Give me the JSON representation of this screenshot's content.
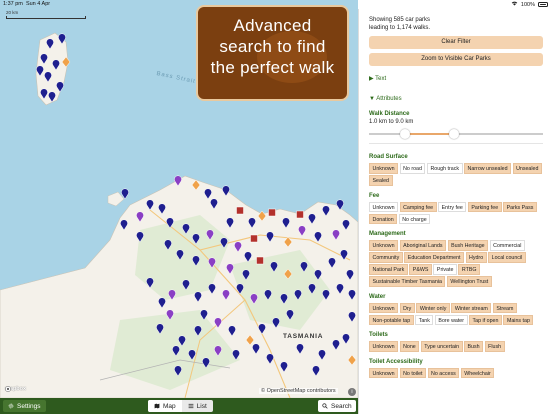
{
  "status": {
    "time": "1:37 pm",
    "date": "Sun 4 Apr",
    "battery": "100%"
  },
  "map": {
    "scale_label": "20 km",
    "sea_label": "Bass Strait",
    "land_label": "TASMANIA",
    "attribution": "© OpenStreetMap contributors",
    "logo": "mapbox",
    "info": "i"
  },
  "promo": {
    "line1": "Advanced",
    "line2": "search to find",
    "line3": "the perfect walk"
  },
  "tabbar": {
    "settings_label": "Settings",
    "map_label": "Map",
    "list_label": "List",
    "search_label": "Search",
    "active_view": "Map"
  },
  "panel": {
    "summary_line1": "Showing 585 car parks",
    "summary_line2": "leading to 1,174 walks.",
    "clear_filter": "Clear Filter",
    "zoom_visible": "Zoom to Visible Car Parks",
    "text_section": "▶ Text",
    "attributes_section": "▼ Attributes",
    "walk_distance": {
      "label": "Walk Distance",
      "range": "1.0 km to 9.0 km",
      "min_fraction": 0.19,
      "max_fraction": 0.49
    },
    "filters": [
      {
        "title": "Road Surface",
        "options": [
          {
            "label": "Unknown",
            "on": true
          },
          {
            "label": "No road",
            "on": false
          },
          {
            "label": "Rough track",
            "on": false
          },
          {
            "label": "Narrow unsealed",
            "on": true
          },
          {
            "label": "Unsealed",
            "on": true
          },
          {
            "label": "Sealed",
            "on": true
          }
        ]
      },
      {
        "title": "Fee",
        "options": [
          {
            "label": "Unknown",
            "on": false
          },
          {
            "label": "Camping fee",
            "on": true
          },
          {
            "label": "Entry fee",
            "on": false
          },
          {
            "label": "Parking fee",
            "on": true
          },
          {
            "label": "Parks Pass",
            "on": true
          },
          {
            "label": "Donation",
            "on": true
          },
          {
            "label": "No charge",
            "on": false
          }
        ]
      },
      {
        "title": "Management",
        "options": [
          {
            "label": "Unknown",
            "on": true
          },
          {
            "label": "Aboriginal Lands",
            "on": true
          },
          {
            "label": "Bush Heritage",
            "on": true
          },
          {
            "label": "Commercial",
            "on": false
          },
          {
            "label": "Community",
            "on": true
          },
          {
            "label": "Education Department",
            "on": true
          },
          {
            "label": "Hydro",
            "on": true
          },
          {
            "label": "Local council",
            "on": true
          },
          {
            "label": "National Park",
            "on": true
          },
          {
            "label": "P&WS",
            "on": true
          },
          {
            "label": "Private",
            "on": false
          },
          {
            "label": "RTBG",
            "on": true
          },
          {
            "label": "Sustainable Timber Tasmania",
            "on": true
          },
          {
            "label": "Wellington Trust",
            "on": true
          }
        ]
      },
      {
        "title": "Water",
        "options": [
          {
            "label": "Unknown",
            "on": true
          },
          {
            "label": "Dry",
            "on": true
          },
          {
            "label": "Winter only",
            "on": true
          },
          {
            "label": "Winter stream",
            "on": true
          },
          {
            "label": "Stream",
            "on": true
          },
          {
            "label": "Non-potable tap",
            "on": true
          },
          {
            "label": "Tank",
            "on": false
          },
          {
            "label": "Bore water",
            "on": false
          },
          {
            "label": "Tap if open",
            "on": true
          },
          {
            "label": "Mains tap",
            "on": true
          }
        ]
      },
      {
        "title": "Toilets",
        "options": [
          {
            "label": "Unknown",
            "on": true
          },
          {
            "label": "None",
            "on": true
          },
          {
            "label": "Type uncertain",
            "on": true
          },
          {
            "label": "Bush",
            "on": true
          },
          {
            "label": "Flush",
            "on": true
          }
        ]
      },
      {
        "title": "Toilet Accessibility",
        "options": [
          {
            "label": "Unknown",
            "on": true
          },
          {
            "label": "No toilet",
            "on": true
          },
          {
            "label": "No access",
            "on": true
          },
          {
            "label": "Wheelchair",
            "on": true
          }
        ]
      }
    ]
  },
  "colors": {
    "sea": "#a9d3e6",
    "land": "#f4f1ea",
    "forest": "#d7e8cb",
    "pin_blue": "#1f1f8f",
    "pin_purple": "#8a3fc4",
    "pin_orange": "#f0a24a",
    "pin_red": "#b3312c",
    "chip_on": "#f4d3b0",
    "accent_green": "#2d6a1a",
    "promo_brown": "#7b3f10"
  }
}
